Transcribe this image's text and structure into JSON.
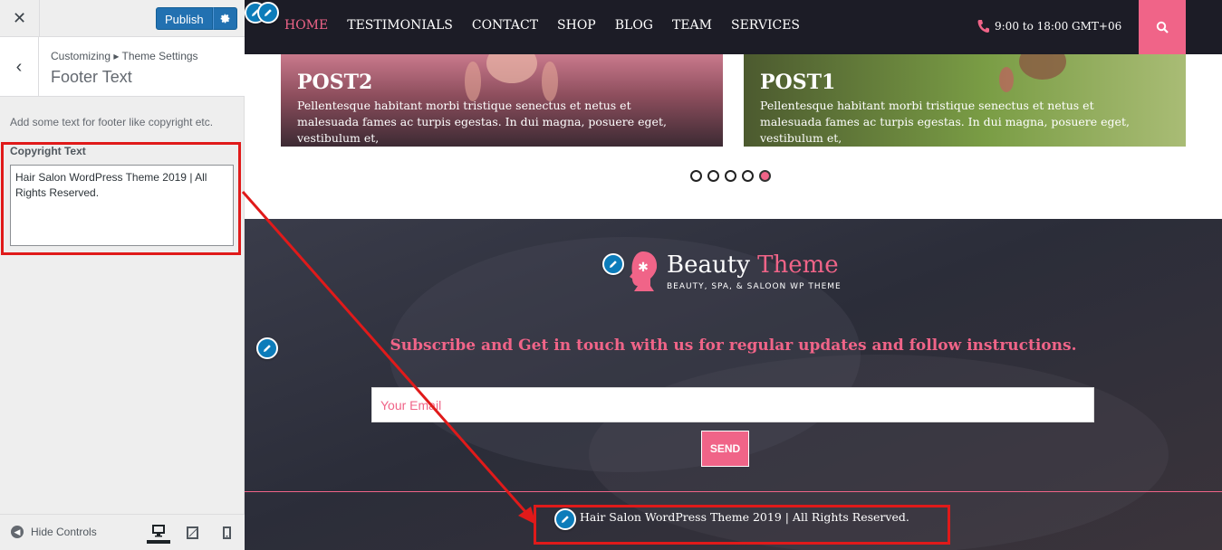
{
  "customizer": {
    "publish_label": "Publish",
    "breadcrumb": "Customizing ▸ Theme Settings",
    "section_title": "Footer Text",
    "description": "Add some text for footer like copyright etc.",
    "copyright_label": "Copyright Text",
    "copyright_value": "Hair Salon WordPress Theme 2019 | All Rights Reserved.",
    "hide_controls": "Hide Controls"
  },
  "nav": {
    "items": [
      "HOME",
      "TESTIMONIALS",
      "CONTACT",
      "SHOP",
      "BLOG",
      "TEAM",
      "SERVICES"
    ],
    "phone": "9:00 to 18:00 GMT+06"
  },
  "posts": [
    {
      "title": "POST2",
      "text": "Pellentesque habitant morbi tristique senectus et netus et malesuada fames ac turpis egestas. In dui magna, posuere eget, vestibulum et,"
    },
    {
      "title": "POST1",
      "text": "Pellentesque habitant morbi tristique senectus et netus et malesuada fames ac turpis egestas. In dui magna, posuere eget, vestibulum et,"
    }
  ],
  "footer": {
    "logo_word1": "Beauty",
    "logo_word2": "Theme",
    "tagline": "BEAUTY, SPA, & SALOON WP THEME",
    "subscribe_text": "Subscribe and Get in touch with us for regular updates and follow instructions.",
    "email_placeholder": "Your Email",
    "send_label": "SEND",
    "copyright": "Hair Salon WordPress Theme 2019 | All Rights Reserved."
  },
  "colors": {
    "accent": "#f06488",
    "navbar": "#1c1c26",
    "wp_blue": "#2271b1",
    "highlight": "#e01a1a"
  },
  "icons": [
    "close-icon",
    "gear-icon",
    "back-chevron-icon",
    "pencil-icon",
    "phone-icon",
    "search-icon",
    "desktop-icon",
    "tablet-icon",
    "mobile-icon",
    "hide-controls-icon"
  ]
}
